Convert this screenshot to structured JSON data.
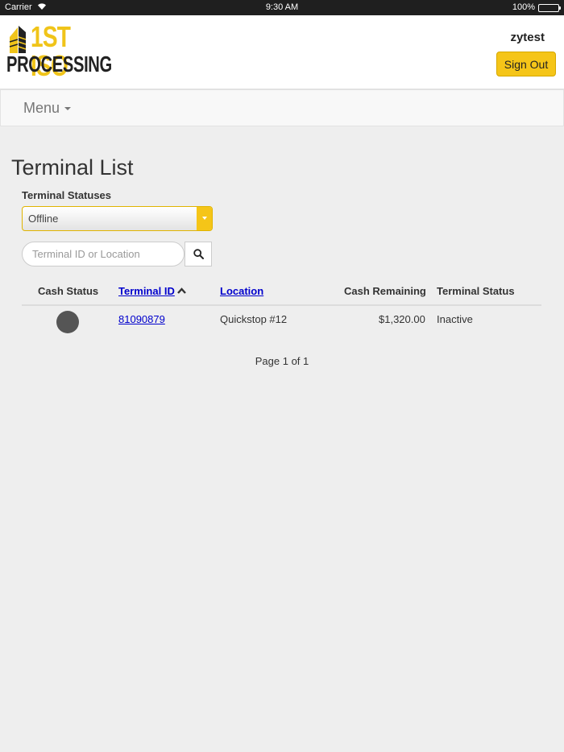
{
  "status_bar": {
    "carrier": "Carrier",
    "time": "9:30 AM",
    "battery": "100%"
  },
  "header": {
    "logo_line1": "1ST ISO",
    "logo_line2": "PROCESSING",
    "username": "zytest",
    "sign_out_label": "Sign Out"
  },
  "nav": {
    "menu_label": "Menu"
  },
  "page": {
    "title": "Terminal List",
    "filter_label": "Terminal Statuses",
    "filter_selected": "Offline",
    "search_placeholder": "Terminal ID or Location"
  },
  "table": {
    "columns": {
      "cash_status": "Cash Status",
      "terminal_id": "Terminal ID",
      "location": "Location",
      "cash_remaining": "Cash Remaining",
      "terminal_status": "Terminal Status"
    },
    "sort": {
      "column": "terminal_id",
      "direction": "ascending"
    },
    "rows": [
      {
        "cash_status_color": "#555555",
        "terminal_id": "81090879",
        "location": "Quickstop #12",
        "cash_remaining": "$1,320.00",
        "terminal_status": "Inactive"
      }
    ]
  },
  "pager": {
    "text": "Page 1 of 1"
  },
  "colors": {
    "accent": "#f5c518",
    "link": "#0000cc",
    "background": "#eeeeee"
  }
}
